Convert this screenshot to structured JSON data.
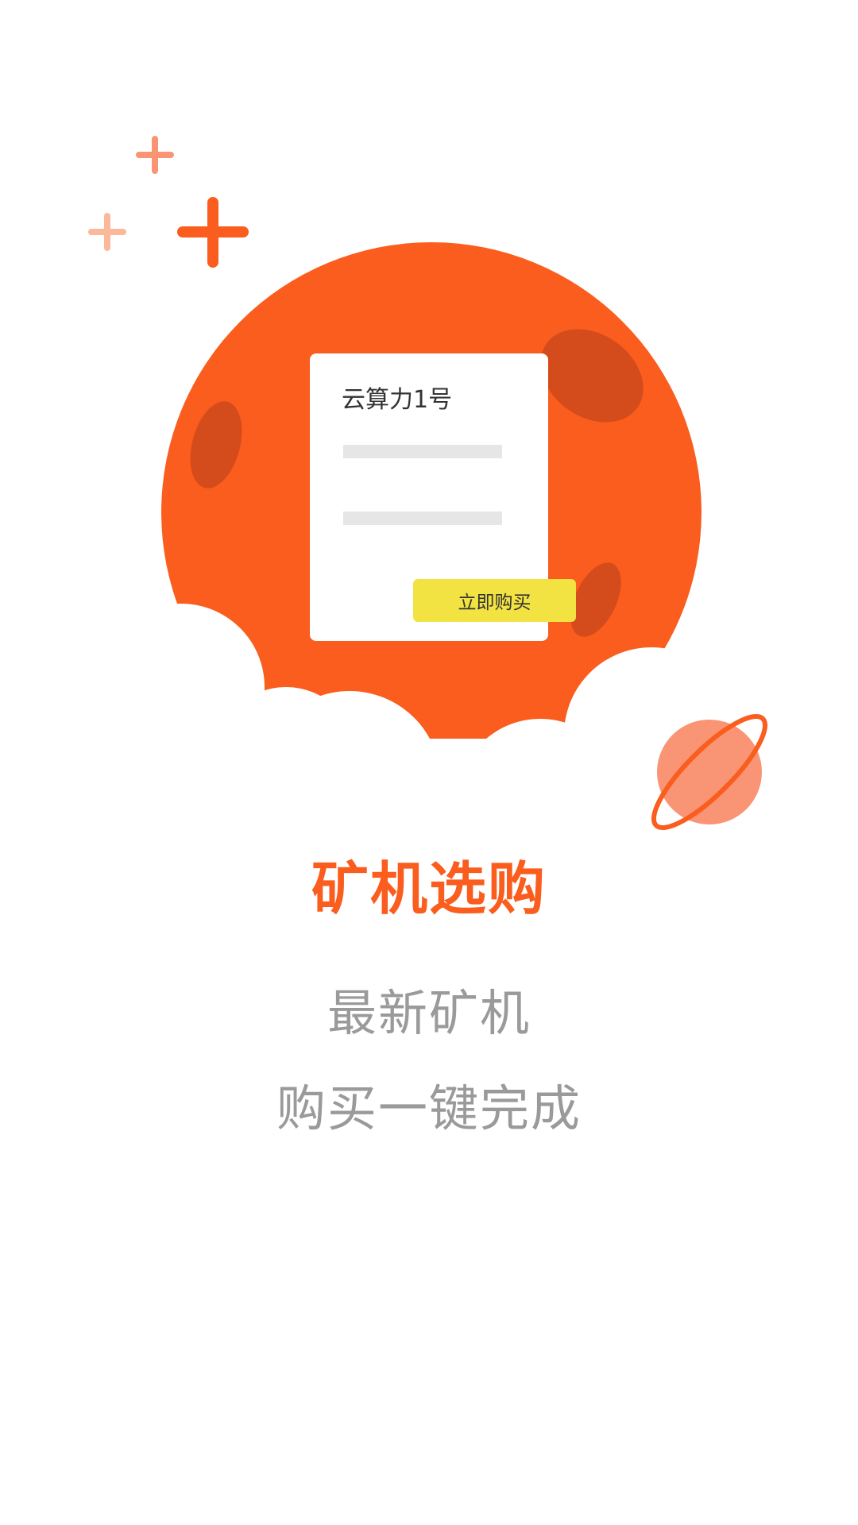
{
  "card": {
    "title": "云算力1号",
    "buy_label": "立即购买"
  },
  "intro": {
    "headline": "矿机选购",
    "line1": "最新矿机",
    "line2": "购买一键完成"
  },
  "colors": {
    "brand": "#fa5d1d",
    "crater": "#d44b1c",
    "planet": "#f99574",
    "button": "#f2e342",
    "sparkle_light": "#fbb89a",
    "sparkle_mid": "#f99574"
  },
  "icons": [
    "sparkle-icon",
    "moon-illustration",
    "planet-icon",
    "cloud-illustration"
  ]
}
